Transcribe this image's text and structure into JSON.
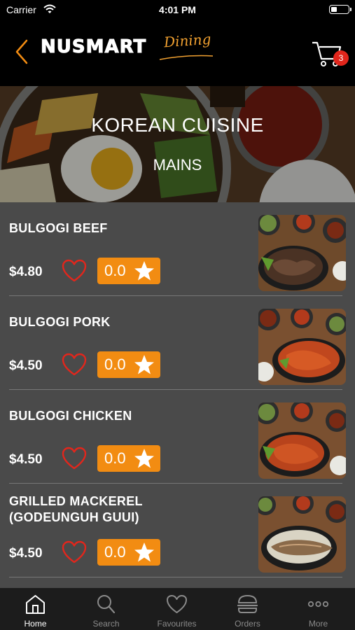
{
  "status_bar": {
    "carrier": "Carrier",
    "time": "4:01 PM"
  },
  "header": {
    "logo_main": "NUSMART",
    "logo_script": "Dining",
    "cart_count": "3"
  },
  "hero": {
    "title": "KOREAN CUISINE",
    "subtitle": "MAINS"
  },
  "menu_items": [
    {
      "name": "BULGOGI BEEF",
      "price": "$4.80",
      "rating": "0.0"
    },
    {
      "name": "BULGOGI PORK",
      "price": "$4.50",
      "rating": "0.0"
    },
    {
      "name": "BULGOGI CHICKEN",
      "price": "$4.50",
      "rating": "0.0"
    },
    {
      "name": "GRILLED MACKEREL\n(GODEUNGUH  GUUI)",
      "price": "$4.50",
      "rating": "0.0"
    }
  ],
  "tabs": [
    {
      "label": "Home",
      "icon": "home-icon",
      "active": true
    },
    {
      "label": "Search",
      "icon": "search-icon",
      "active": false
    },
    {
      "label": "Favourites",
      "icon": "heart-icon",
      "active": false
    },
    {
      "label": "Orders",
      "icon": "burger-icon",
      "active": false
    },
    {
      "label": "More",
      "icon": "more-icon",
      "active": false
    }
  ],
  "colors": {
    "accent": "#f28c12",
    "heart": "#e2261c",
    "list_bg": "#4a4a4a",
    "tab_bg": "#1c1c1c"
  }
}
